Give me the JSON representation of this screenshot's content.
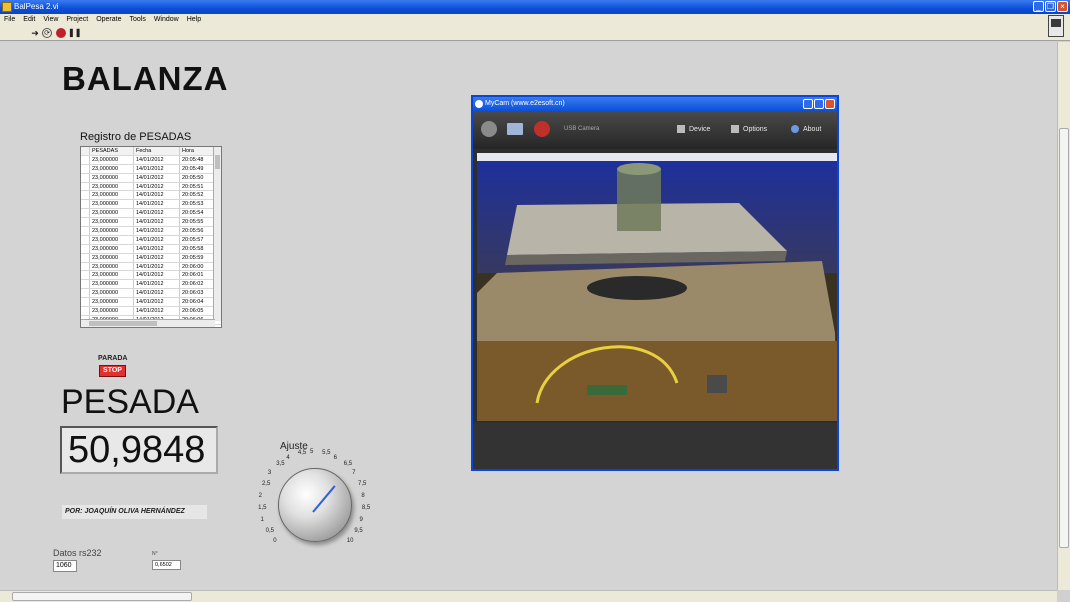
{
  "window": {
    "title": "BalPesa 2.vi"
  },
  "menu": [
    "File",
    "Edit",
    "View",
    "Project",
    "Operate",
    "Tools",
    "Window",
    "Help"
  ],
  "toolbar": {
    "run": "run-arrow",
    "run_continuous": "run-continuously",
    "abort": "abort-execution",
    "pause": "pause"
  },
  "panel": {
    "title": "BALANZA",
    "registro": {
      "label": "Registro de PESADAS",
      "columns": [
        "PESADAS",
        "Fecha",
        "Hora"
      ],
      "rows": [
        [
          "23,000000",
          "14/01/2012",
          "20:05:48"
        ],
        [
          "23,000000",
          "14/01/2012",
          "20:05:49"
        ],
        [
          "23,000000",
          "14/01/2012",
          "20:05:50"
        ],
        [
          "23,000000",
          "14/01/2012",
          "20:05:51"
        ],
        [
          "23,000000",
          "14/01/2012",
          "20:05:52"
        ],
        [
          "23,000000",
          "14/01/2012",
          "20:05:53"
        ],
        [
          "23,000000",
          "14/01/2012",
          "20:05:54"
        ],
        [
          "23,000000",
          "14/01/2012",
          "20:05:55"
        ],
        [
          "23,000000",
          "14/01/2012",
          "20:05:56"
        ],
        [
          "23,000000",
          "14/01/2012",
          "20:05:57"
        ],
        [
          "23,000000",
          "14/01/2012",
          "20:05:58"
        ],
        [
          "23,000000",
          "14/01/2012",
          "20:05:59"
        ],
        [
          "23,000000",
          "14/01/2012",
          "20:06:00"
        ],
        [
          "23,000000",
          "14/01/2012",
          "20:06:01"
        ],
        [
          "23,000000",
          "14/01/2012",
          "20:06:02"
        ],
        [
          "23,000000",
          "14/01/2012",
          "20:06:03"
        ],
        [
          "23,000000",
          "14/01/2012",
          "20:06:04"
        ],
        [
          "23,000000",
          "14/01/2012",
          "20:06:05"
        ],
        [
          "23,000000",
          "14/01/2012",
          "20:06:06"
        ]
      ]
    },
    "stop": {
      "label": "PARADA",
      "button": "STOP"
    },
    "pesada": {
      "label": "PESADA",
      "value": "50,9848"
    },
    "author": "POR: JOAQUÍN OLIVA HERNÁNDEZ",
    "datos": {
      "label": "Datos rs232",
      "value": "1060"
    },
    "n": {
      "label": "N°",
      "value": "0,6502"
    },
    "ajuste": {
      "label": "Ajuste",
      "ticks": [
        "0",
        "0,5",
        "1",
        "1,5",
        "2",
        "2,5",
        "3",
        "3,5",
        "4",
        "4,5",
        "5",
        "5,5",
        "6",
        "6,5",
        "7",
        "7,5",
        "8",
        "8,5",
        "9",
        "9,5",
        "10"
      ]
    }
  },
  "mycam": {
    "title": "MyCam (www.e2esoft.cn)",
    "camera": "USB Camera",
    "menu": [
      "Device",
      "Options",
      "About"
    ]
  }
}
